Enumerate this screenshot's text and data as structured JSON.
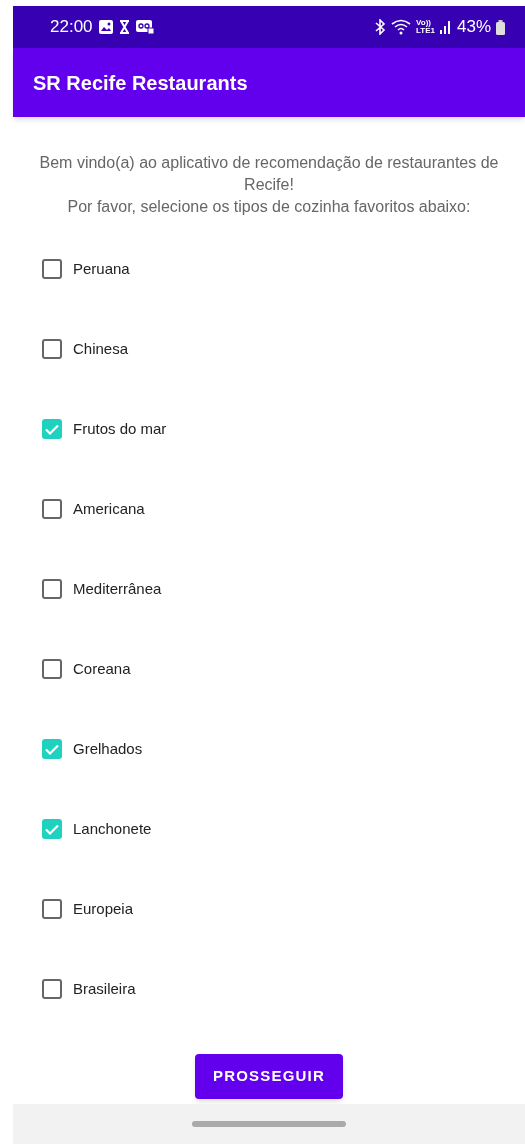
{
  "status_bar": {
    "time": "22:00",
    "network_top": "Vo))",
    "network_bottom": "LTE1",
    "battery": "43%"
  },
  "app_bar": {
    "title": "SR Recife Restaurants"
  },
  "intro": [
    "Bem vindo(a) ao aplicativo de recomendação de restaurantes de Recife!",
    "Por favor, selecione os tipos de cozinha favoritos abaixo:"
  ],
  "options": [
    {
      "label": "Peruana",
      "checked": false
    },
    {
      "label": "Chinesa",
      "checked": false
    },
    {
      "label": "Frutos do mar",
      "checked": true
    },
    {
      "label": "Americana",
      "checked": false
    },
    {
      "label": "Mediterrânea",
      "checked": false
    },
    {
      "label": "Coreana",
      "checked": false
    },
    {
      "label": "Grelhados",
      "checked": true
    },
    {
      "label": "Lanchonete",
      "checked": true
    },
    {
      "label": "Europeia",
      "checked": false
    },
    {
      "label": "Brasileira",
      "checked": false
    }
  ],
  "button": {
    "label": "PROSSEGUIR"
  }
}
